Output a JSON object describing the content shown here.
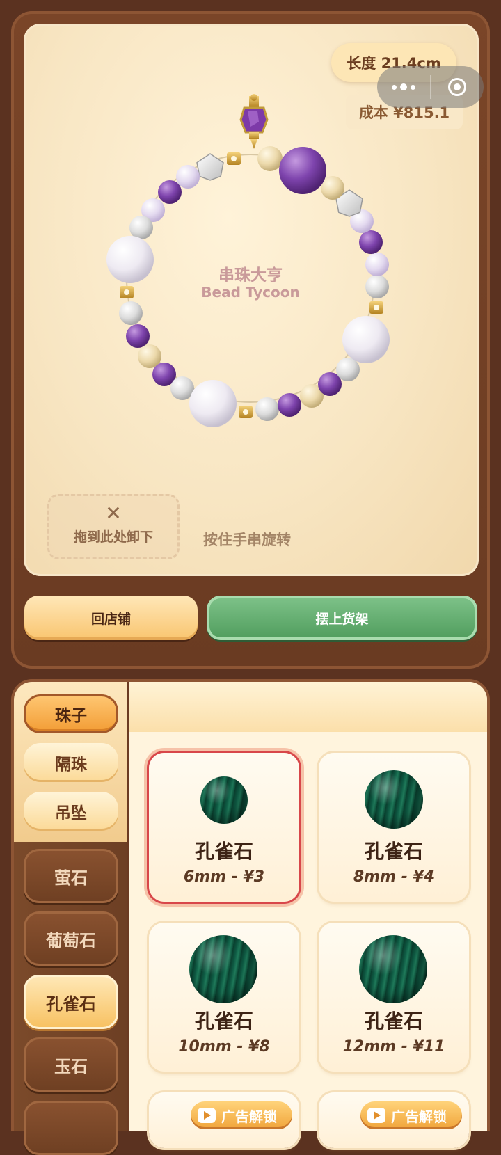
{
  "header": {
    "length_label": "长度 21.4cm",
    "cost_label": "成本 ¥815.1"
  },
  "brand": {
    "title_cn": "串珠大亨",
    "title_en": "Bead Tycoon"
  },
  "workspace": {
    "drop_zone_icon": "close-icon",
    "drop_zone_label": "拖到此处卸下",
    "rotate_hint": "按住手串旋转"
  },
  "actions": {
    "back_label": "回店铺",
    "shelf_label": "摆上货架"
  },
  "tabs": [
    {
      "label": "珠子",
      "active": true
    },
    {
      "label": "隔珠",
      "active": false
    },
    {
      "label": "吊坠",
      "active": false
    }
  ],
  "categories": [
    {
      "label": "萤石",
      "active": false
    },
    {
      "label": "葡萄石",
      "active": false
    },
    {
      "label": "孔雀石",
      "active": true
    },
    {
      "label": "玉石",
      "active": false
    }
  ],
  "products": [
    {
      "name": "孔雀石",
      "spec": "6mm - ¥3",
      "selected": true
    },
    {
      "name": "孔雀石",
      "spec": "8mm - ¥4",
      "selected": false
    },
    {
      "name": "孔雀石",
      "spec": "10mm - ¥8",
      "selected": false
    },
    {
      "name": "孔雀石",
      "spec": "12mm - ¥11",
      "selected": false
    }
  ],
  "locked": [
    {
      "label": "广告解锁",
      "icon": "play-icon"
    },
    {
      "label": "广告解锁",
      "icon": "play-icon"
    }
  ],
  "colors": {
    "frame": "#6b3b22",
    "canvas": "#f8e6c3",
    "primary_green": "#4f9c5c",
    "accent_orange": "#f29b33",
    "selected_border": "#d8474a",
    "malachite": "#0e5a43"
  }
}
